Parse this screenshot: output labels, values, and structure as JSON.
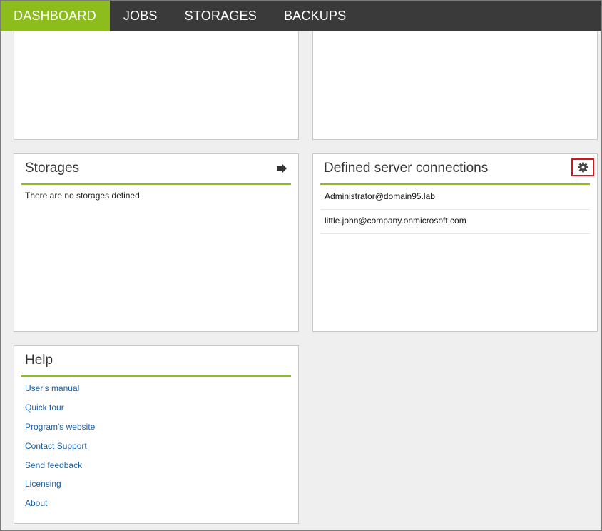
{
  "nav": {
    "tabs": [
      {
        "label": "DASHBOARD",
        "active": true
      },
      {
        "label": "JOBS"
      },
      {
        "label": "STORAGES"
      },
      {
        "label": "BACKUPS"
      }
    ]
  },
  "storages": {
    "title": "Storages",
    "empty_text": "There are no storages defined.",
    "icon": "arrow-right-icon"
  },
  "connections": {
    "title": "Defined server connections",
    "icon": "gear-icon",
    "items": [
      "Administrator@domain95.lab",
      "little.john@company.onmicrosoft.com"
    ]
  },
  "help": {
    "title": "Help",
    "links": [
      "User's manual",
      "Quick tour",
      "Program's website",
      "Contact Support",
      "Send feedback",
      "Licensing",
      "About"
    ]
  },
  "colors": {
    "accent": "#8cbd1c",
    "nav_bg": "#3a3a3a",
    "link": "#1a5fa6",
    "highlight": "#d9141c"
  }
}
